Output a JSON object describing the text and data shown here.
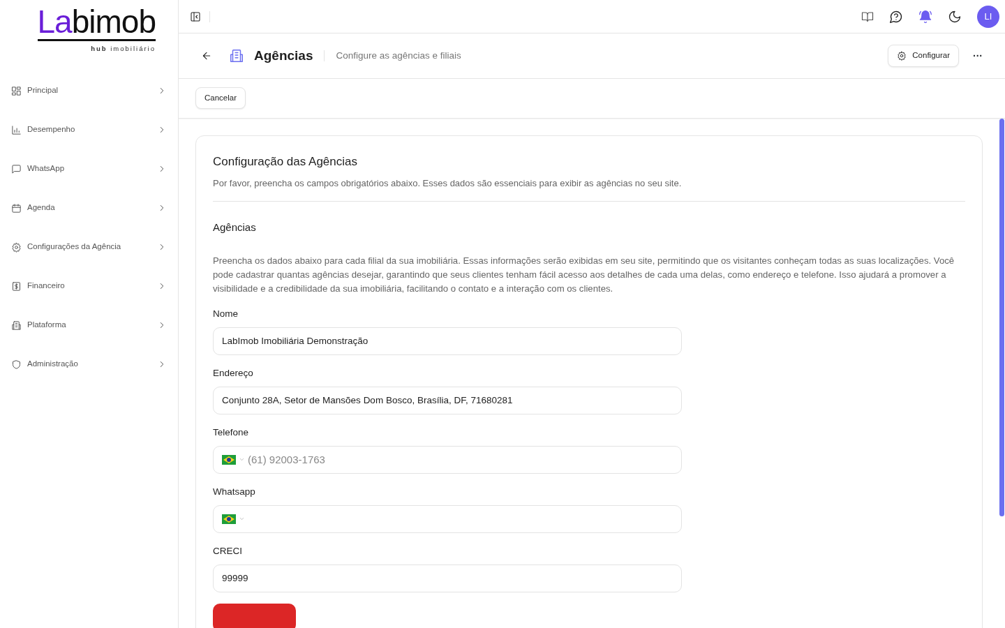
{
  "logo": {
    "part_1": "La",
    "part_2": "b",
    "part_3": "imob",
    "tagline_bold": "hub",
    "tagline": "imobiliário"
  },
  "sidebar": {
    "items": [
      {
        "label": "Principal"
      },
      {
        "label": "Desempenho"
      },
      {
        "label": "WhatsApp"
      },
      {
        "label": "Agenda"
      },
      {
        "label": "Configurações da Agência"
      },
      {
        "label": "Financeiro"
      },
      {
        "label": "Plataforma"
      },
      {
        "label": "Administração"
      }
    ]
  },
  "topbar": {
    "avatar": "LI"
  },
  "header": {
    "title": "Agências",
    "subtitle": "Configure as agências e filiais",
    "configure_button": "Configurar",
    "more": "···"
  },
  "toolbar": {
    "cancel_button": "Cancelar"
  },
  "card": {
    "title": "Configuração das Agências",
    "description": "Por favor, preencha os campos obrigatórios abaixo. Esses dados são essenciais para exibir as agências no seu site.",
    "section_title": "Agências",
    "section_text": "Preencha os dados abaixo para cada filial da sua imobiliária. Essas informações serão exibidas em seu site, permitindo que os visitantes conheçam todas as suas localizações. Você pode cadastrar quantas agências desejar, garantindo que seus clientes tenham fácil acesso aos detalhes de cada uma delas, como endereço e telefone. Isso ajudará a promover a visibilidade e a credibilidade da sua imobiliária, facilitando o contato e a interação com os clientes.",
    "fields": [
      {
        "kind": "text",
        "label": "Nome",
        "value": "LabImob Imobiliária Demonstração"
      },
      {
        "kind": "text",
        "label": "Endereço",
        "value": "Conjunto 28A, Setor de Mansões Dom Bosco, Brasília, DF, 71680281"
      },
      {
        "kind": "phone",
        "label": "Telefone",
        "placeholder": "(61) 92003-1763"
      },
      {
        "kind": "phone",
        "label": "Whatsapp"
      },
      {
        "kind": "text",
        "label": "CRECI",
        "value": "99999"
      }
    ],
    "danger_button": {
      "kind": "danger"
    }
  }
}
